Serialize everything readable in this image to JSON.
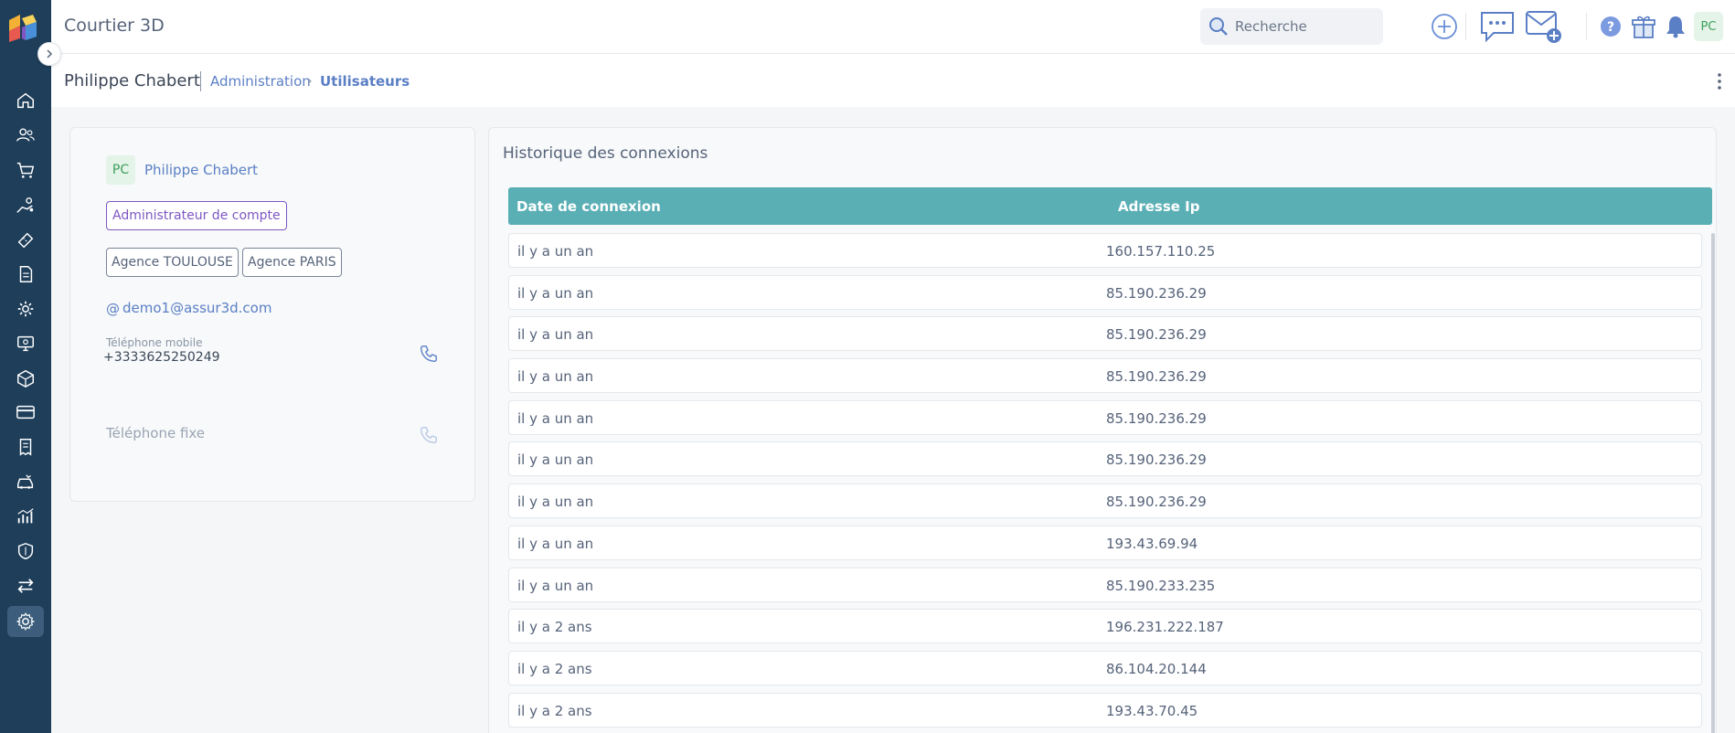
{
  "app": {
    "title": "Courtier 3D"
  },
  "search": {
    "placeholder": "Recherche"
  },
  "user_initials": "PC",
  "breadcrumb": {
    "name": "Philippe Chabert",
    "level1": "Administration",
    "level2": "Utilisateurs"
  },
  "sidebar": {
    "icons": [
      "home-icon",
      "users-icon",
      "cart-icon",
      "hand-coins-icon",
      "ticket-icon",
      "document-icon",
      "gear-cog-icon",
      "monitor-money-icon",
      "box-icon",
      "credit-card-icon",
      "receipt-icon",
      "car-damage-icon",
      "chart-icon",
      "shield-icon",
      "transfer-icon",
      "settings-icon"
    ],
    "active": "settings-icon"
  },
  "profile": {
    "initials": "PC",
    "name": "Philippe Chabert",
    "role": "Administrateur de compte",
    "agencies": [
      "Agence TOULOUSE",
      "Agence PARIS"
    ],
    "email_prefix": "@",
    "email": "demo1@assur3d.com",
    "mobile_label": "Téléphone mobile",
    "mobile_value": "+3333625250249",
    "fixe_label": "Téléphone fixe"
  },
  "history": {
    "title": "Historique des connexions",
    "columns": [
      "Date de connexion",
      "Adresse Ip"
    ],
    "rows": [
      [
        "il y a un an",
        "160.157.110.25"
      ],
      [
        "il y a un an",
        "85.190.236.29"
      ],
      [
        "il y a un an",
        "85.190.236.29"
      ],
      [
        "il y a un an",
        "85.190.236.29"
      ],
      [
        "il y a un an",
        "85.190.236.29"
      ],
      [
        "il y a un an",
        "85.190.236.29"
      ],
      [
        "il y a un an",
        "85.190.236.29"
      ],
      [
        "il y a un an",
        "193.43.69.94"
      ],
      [
        "il y a un an",
        "85.190.233.235"
      ],
      [
        "il y a 2 ans",
        "196.231.222.187"
      ],
      [
        "il y a 2 ans",
        "86.104.20.144"
      ],
      [
        "il y a 2 ans",
        "193.43.70.45"
      ]
    ]
  },
  "colors": {
    "sidebar": "#1e3e5a",
    "accent": "#5b7fc5",
    "table_header": "#5aafb5",
    "role": "#7e57c2"
  }
}
